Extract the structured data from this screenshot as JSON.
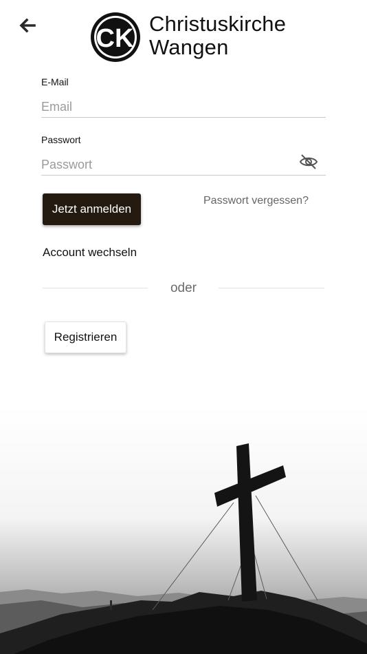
{
  "header": {
    "back_icon": "arrow-left-icon",
    "logo_initials": "CK",
    "logo_line1": "Christuskirche",
    "logo_line2": "Wangen"
  },
  "login": {
    "email_label": "E-Mail",
    "email_placeholder": "Email",
    "password_label": "Passwort",
    "password_placeholder": "Passwort",
    "visibility_icon": "eye-off-icon",
    "submit_label": "Jetzt anmelden",
    "forgot_label": "Passwort vergessen?",
    "switch_account_label": "Account wechseln"
  },
  "divider": {
    "label": "oder"
  },
  "register": {
    "label": "Registrieren"
  },
  "colors": {
    "primary_button": "#241a10",
    "muted_text": "#666666",
    "divider": "#e2e2e2"
  }
}
